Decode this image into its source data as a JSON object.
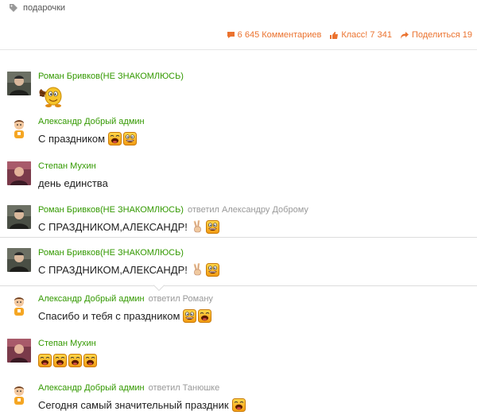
{
  "tag": {
    "label": "подарочки",
    "icon": "tag-icon"
  },
  "stats": {
    "comments": "6 645 Комментариев",
    "likes": "Класс! 7 341",
    "shares": "Поделиться 19"
  },
  "comments": [
    {
      "author": "Роман Бривков(НЕ ЗНАКОМЛЮСЬ)",
      "reply": "",
      "text": "",
      "smileys": [
        "hedgehog-sticker"
      ]
    },
    {
      "author": "Александр Добрый админ",
      "reply": "",
      "text": "С праздником",
      "smileys": [
        "laughing-smiley",
        "grinning-smiley"
      ]
    },
    {
      "author": "Степан Мухин",
      "reply": "",
      "text": "день единства",
      "smileys": []
    },
    {
      "author": "Роман Бривков(НЕ ЗНАКОМЛЮСЬ)",
      "reply": "ответил Александру Доброму",
      "text": "С ПРАЗДНИКОМ,АЛЕКСАНДР!",
      "smileys": [
        "victory-hand",
        "grinning-smiley"
      ]
    },
    {
      "author": "Роман Бривков(НЕ ЗНАКОМЛЮСЬ)",
      "reply": "",
      "text": "С ПРАЗДНИКОМ,АЛЕКСАНДР!",
      "smileys": [
        "victory-hand",
        "grinning-smiley"
      ]
    },
    {
      "author": "Александр Добрый админ",
      "reply": "ответил Роману",
      "text": "Спасибо и тебя с праздником",
      "smileys": [
        "grinning-smiley",
        "laughing-smiley"
      ]
    },
    {
      "author": "Степан Мухин",
      "reply": "",
      "text": "",
      "smileys": [
        "laughing-smiley",
        "laughing-smiley",
        "laughing-smiley",
        "laughing-smiley"
      ]
    },
    {
      "author": "Александр Добрый админ",
      "reply": "ответил Танюшке",
      "text": "Сегодня самый значительный праздник",
      "smileys": [
        "laughing-smiley"
      ]
    }
  ],
  "colors": {
    "accent": "#eb722e",
    "author": "#339900",
    "meta": "#999999"
  }
}
